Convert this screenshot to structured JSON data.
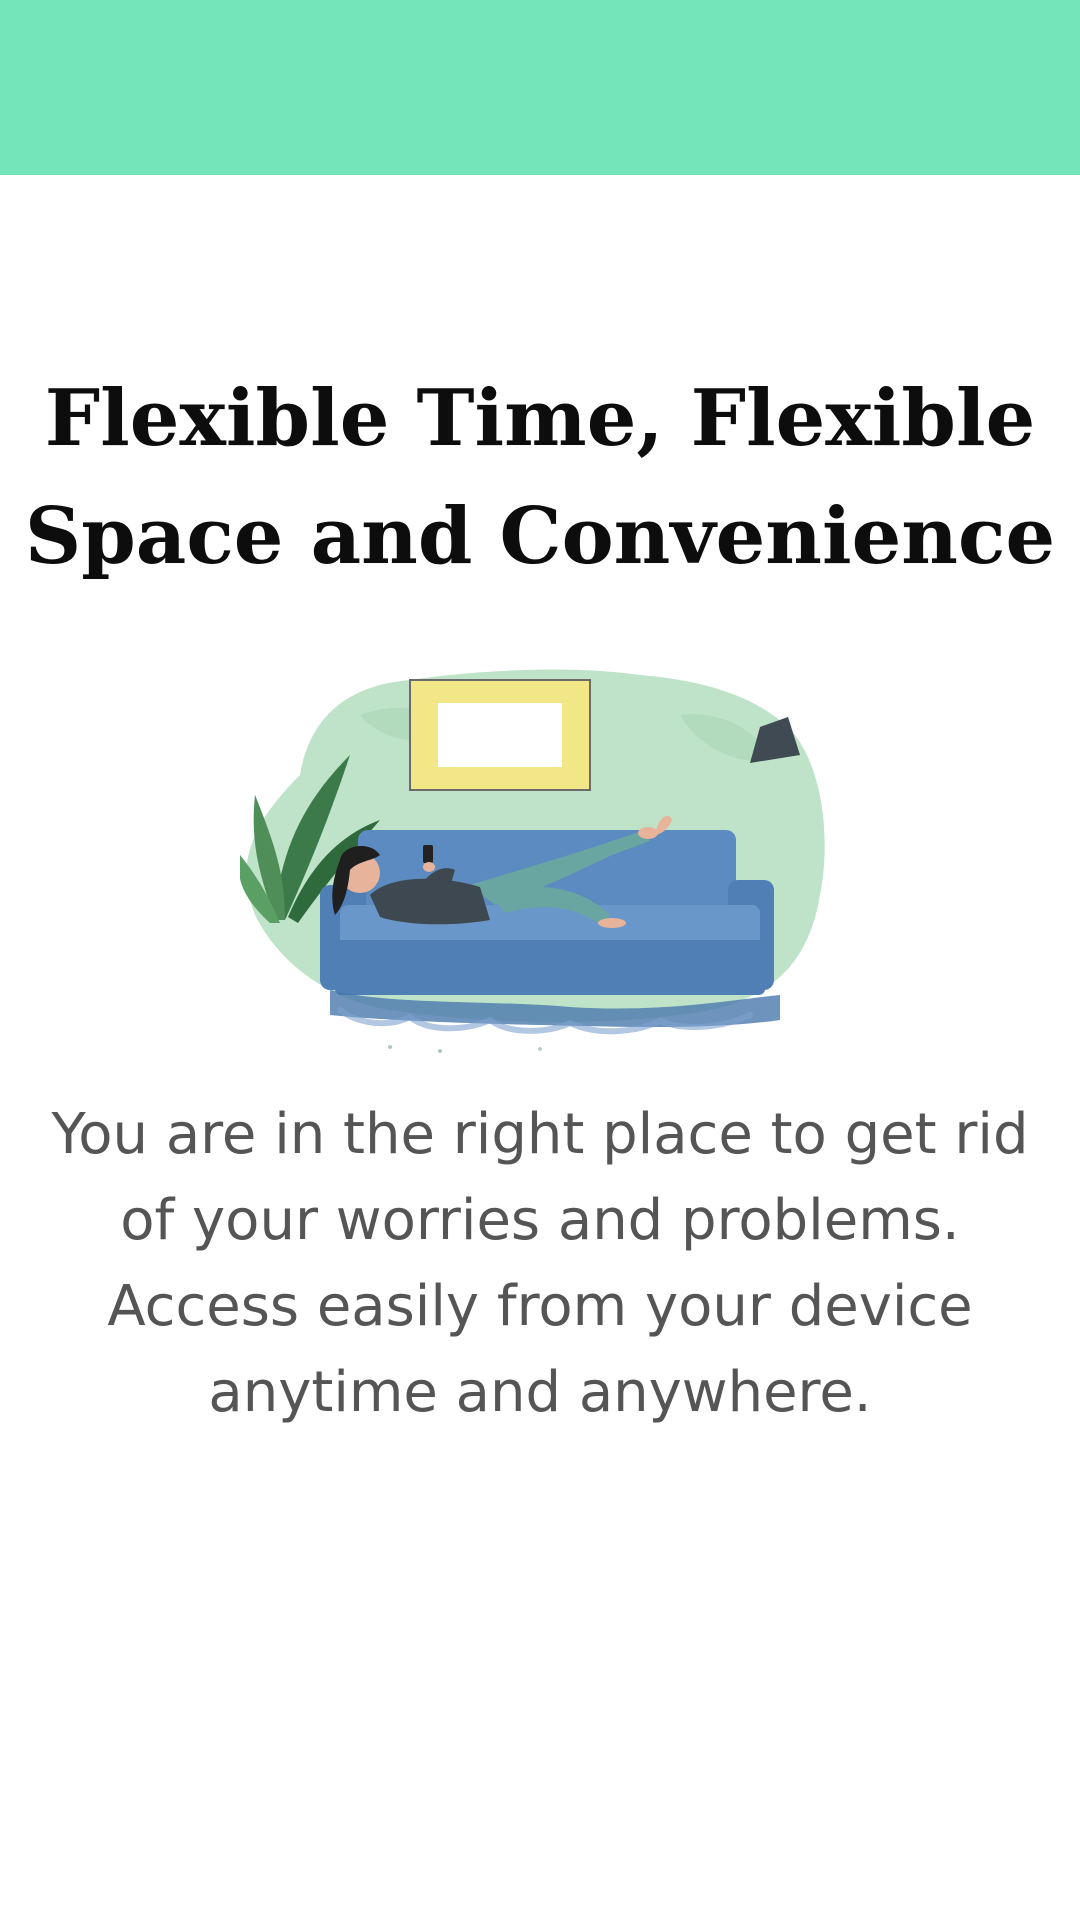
{
  "colors": {
    "top_bar": "#74E4BB",
    "title": "#0d0d0d",
    "description": "#555555",
    "wall": "#bfe3c8",
    "sofa": "#4f7fb5",
    "frame": "#f2e787"
  },
  "onboarding": {
    "title": "Flexible Time, Flexible Space and Convenience",
    "description": "You are in the right place to get rid of your worries and problems. Access easily from your device anytime and anywhere.",
    "illustration": "woman-relaxing-on-sofa-with-phone-illustration"
  }
}
